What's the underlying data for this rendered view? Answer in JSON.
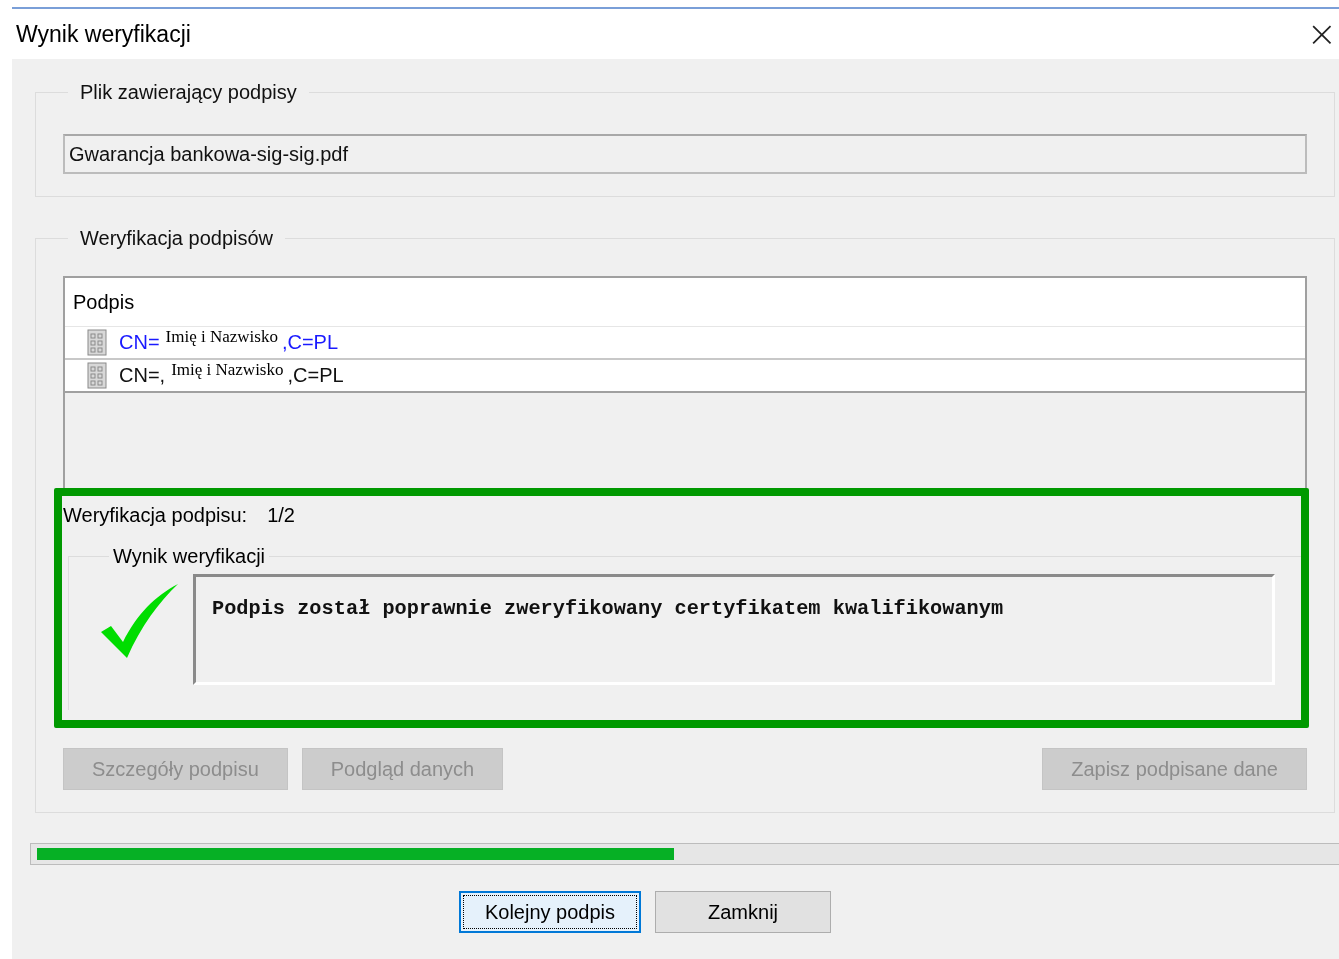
{
  "window": {
    "title": "Wynik weryfikacji",
    "close": "×"
  },
  "file_group": {
    "title": "Plik zawierający podpisy",
    "value": "Gwarancja bankowa-sig-sig.pdf"
  },
  "verification_group": {
    "title": "Weryfikacja podpisów",
    "list": {
      "column": "Podpis",
      "rows": [
        {
          "prefix": "CN=",
          "overlay": "Imię i Nazwisko",
          "suffix": ",C=PL",
          "selected": true
        },
        {
          "prefix": "CN=,",
          "overlay": "Imię i Nazwisko",
          "suffix": ",C=PL",
          "selected": false
        }
      ]
    },
    "status": {
      "label": "Weryfikacja podpisu:",
      "value": "1/2"
    },
    "result": {
      "title": "Wynik weryfikacji",
      "valid": true,
      "message": "Podpis został poprawnie zweryfikowany certyfikatem kwalifikowanym"
    },
    "left_buttons": [
      {
        "label": "Szczegóły podpisu",
        "disabled": true
      },
      {
        "label": "Podgląd danych",
        "disabled": true
      }
    ],
    "right_buttons": [
      {
        "label": "Zapisz podpisane dane",
        "disabled": true
      }
    ]
  },
  "progress": {
    "level": 0.49
  },
  "footer_buttons": [
    {
      "label": "Kolejny podpis",
      "focused": true
    },
    {
      "label": "Zamknij",
      "focused": false
    }
  ]
}
